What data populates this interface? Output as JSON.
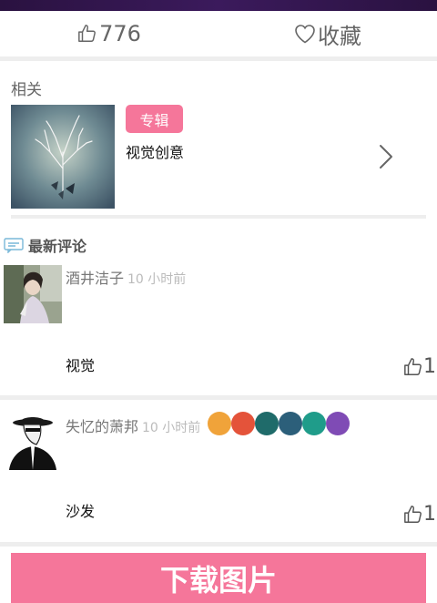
{
  "actions": {
    "like_count": "776",
    "favorite_label": "收藏"
  },
  "related": {
    "title": "相关",
    "badge": "专辑",
    "name": "视觉创意"
  },
  "comments": {
    "heading": "最新评论",
    "items": [
      {
        "user": "酒井洁子",
        "time": "10 小时前",
        "text": "视觉",
        "likes": "1"
      },
      {
        "user": "失忆的萧邦",
        "time": "10 小时前",
        "text": "沙发",
        "likes": "1"
      }
    ]
  },
  "download_label": "下载图片",
  "colors": {
    "accent": "#f5769a",
    "header": "#2a1240"
  },
  "icons": [
    "thumbs-up-icon",
    "heart-icon",
    "chevron-right-icon",
    "comment-icon"
  ]
}
